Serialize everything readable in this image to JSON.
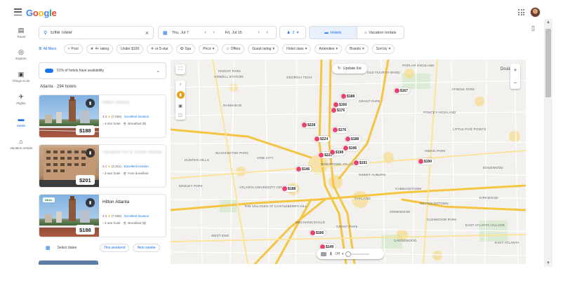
{
  "app": {
    "logo": "Google"
  },
  "nav": {
    "items": [
      {
        "label": "Travel",
        "icon": "suitcase-icon"
      },
      {
        "label": "Explore",
        "icon": "explore-icon"
      },
      {
        "label": "Things to do",
        "icon": "camera-icon"
      },
      {
        "label": "Flights",
        "icon": "plane-icon"
      },
      {
        "label": "Hotels",
        "icon": "bed-icon"
      },
      {
        "label": "Vacation rentals",
        "icon": "house-icon"
      }
    ]
  },
  "search": {
    "value": "Eiffel Tower",
    "placeholder": "Search for places, hotels and more"
  },
  "dates": {
    "checkin": "Thu, Jul 7",
    "checkout": "Fri, Jul 15"
  },
  "guests": {
    "count": "2"
  },
  "segments": {
    "hotels": "Hotels",
    "rentals": "Vacation rentals"
  },
  "filters": [
    {
      "label": "All filters",
      "icon": "≣"
    },
    {
      "label": "Pool",
      "icon": "≈"
    },
    {
      "label": "4+ rating",
      "icon": "★"
    },
    {
      "label": "Under $100",
      "icon": ""
    },
    {
      "label": "4- or 5-star",
      "icon": ""
    },
    {
      "label": "Spa",
      "icon": "✿"
    },
    {
      "label": "Price",
      "icon": "▾"
    },
    {
      "label": "Offers",
      "icon": "◇"
    },
    {
      "label": "Guest rating",
      "icon": "▾"
    },
    {
      "label": "Hotel class",
      "icon": "▾"
    },
    {
      "label": "Amenities",
      "icon": "▾"
    },
    {
      "label": "Brands",
      "icon": "▾"
    },
    {
      "label": "Sort by",
      "icon": "▾"
    }
  ],
  "availability": {
    "text": "51% of hotels have availability"
  },
  "list": {
    "title": "Atlanta · 294 hotels"
  },
  "hotels": [
    {
      "name": "Hilton Atlanta",
      "price": "$188",
      "deal": "",
      "rating": "4.2",
      "reviews": "(7,558)",
      "badge": "Excellent location",
      "class": "4-star hotel",
      "extra": "Breakfast ($)"
    },
    {
      "name": "Hampton Inn & Suites Atlanta",
      "price": "$201",
      "deal": "",
      "rating": "4.1",
      "reviews": "(2,311)",
      "badge": "Excellent location",
      "class": "3-star hotel",
      "extra": "Free breakfast"
    },
    {
      "name": "Hilton Atlanta",
      "price": "$188",
      "deal": "DEAL",
      "rating": "4.2",
      "reviews": "(7,558)",
      "badge": "Excellent location",
      "class": "4-star hotel",
      "extra": "Breakfast ($)"
    }
  ],
  "date_bar": {
    "label": "Select dates",
    "this_weekend": "This weekend",
    "next_weekend": "Next weeke"
  },
  "map": {
    "update_label": "Update list",
    "peg_label": "Off",
    "pins": [
      "$188",
      "$176",
      "$228",
      "$176",
      "$224",
      "$188",
      "$220",
      "$196",
      "$198",
      "$190",
      "$146",
      "$188",
      "$166",
      "$149",
      "$167",
      "$191",
      "$166"
    ],
    "places": [
      "KNIGHT PARK",
      "HOWELL STATION",
      "GEORGIA TECH",
      "OLD FOURTH WARD",
      "POPLAR HIGHLAND",
      "ATHENS PARK",
      "RANKHEAD",
      "GRANT PARK",
      "PONCEY-HIGHLAND",
      "LITTLE FIVE POINTS",
      "WASHINGTON PARK",
      "VINE CITY",
      "INMAN PARK",
      "SWEET AUBURN",
      "HUNTER HILLS",
      "MOZLEY PARK",
      "ATLANTA UNIVERSITY CENTER",
      "DOWNTOWN ATLANTA",
      "CABBAGETOWN",
      "REYNOLDSTOWN",
      "EDGEWOOD",
      "OAKLAND",
      "ORMEWOOD",
      "KIRKWOOD",
      "THE VILLAGES AT CASTLEBERRY HILL",
      "MECHANICSVILLE",
      "GLENWOOD PARK",
      "EAST ATLANTA VILLAGE",
      "WEST END",
      "GRANT PARK",
      "CHOSEWOOD",
      "EAST ATLANTA",
      "Druid"
    ]
  }
}
